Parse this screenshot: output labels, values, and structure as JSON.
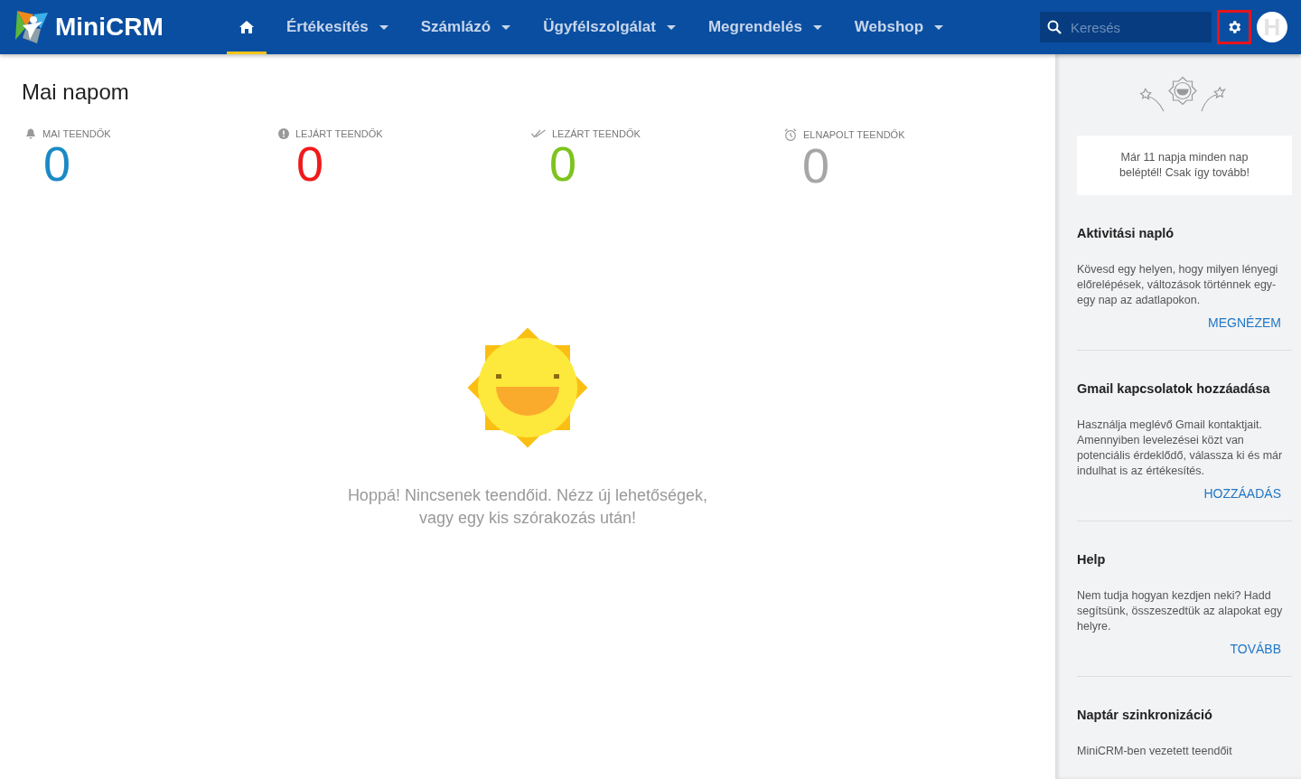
{
  "header": {
    "logo": "MiniCRM",
    "nav": [
      {
        "kind": "home",
        "selected": true,
        "dropdown": false
      },
      {
        "kind": "menu",
        "label": "Értékesítés",
        "selected": false,
        "dropdown": true
      },
      {
        "kind": "menu",
        "label": "Számlázó",
        "selected": false,
        "dropdown": true
      },
      {
        "kind": "menu",
        "label": "Ügyfélszolgálat",
        "selected": false,
        "dropdown": true
      },
      {
        "kind": "menu",
        "label": "Megrendelés",
        "selected": false,
        "dropdown": true
      },
      {
        "kind": "menu",
        "label": "Webshop",
        "selected": false,
        "dropdown": true
      }
    ],
    "search": {
      "placeholder": "Keresés"
    },
    "settings": {
      "highlighted": true
    },
    "avatar": "H"
  },
  "main": {
    "title": "Mai napom",
    "stats": [
      {
        "kind": "bell",
        "label": "MAI TEENDŐK",
        "value": "0",
        "color": "#1a8ac4"
      },
      {
        "kind": "alert",
        "label": "LEJÁRT TEENDŐK",
        "value": "0",
        "color": "#f01a1a"
      },
      {
        "kind": "check",
        "label": "LEZÁRT TEENDŐK",
        "value": "0",
        "color": "#7dc31e"
      },
      {
        "kind": "clock",
        "label": "ELNAPOLT TEENDŐK",
        "value": "0",
        "color": "#a6a6a6"
      }
    ],
    "empty_message": [
      "Hoppá! Nincsenek teendőid. Nézz új lehetőségek,",
      "vagy egy kis szórakozás után!"
    ]
  },
  "sidebar": {
    "streak": "Már 11 napja minden nap beléptél! Csak így tovább!",
    "sections": [
      {
        "title": "Aktivitási napló",
        "text": "Kövesd egy helyen, hogy milyen lényegi előrelépések, változások történnek egy-egy nap az adatlapokon.",
        "link": "MEGNÉZEM"
      },
      {
        "title": "Gmail kapcsolatok hozzáadása",
        "text": "Használja meglévő Gmail kontaktjait. Amennyiben levelezései közt van potenciális érdeklődő, válassza ki és már indulhat is az értékesítés.",
        "link": "HOZZÁADÁS"
      },
      {
        "title": "Help",
        "text": "Nem tudja hogyan kezdjen neki? Hadd segítsünk, összeszedtük az alapokat egy helyre.",
        "link": "TOVÁBB"
      },
      {
        "title": "Naptár szinkronizáció",
        "text": "MiniCRM-ben vezetett teendőit"
      }
    ]
  }
}
